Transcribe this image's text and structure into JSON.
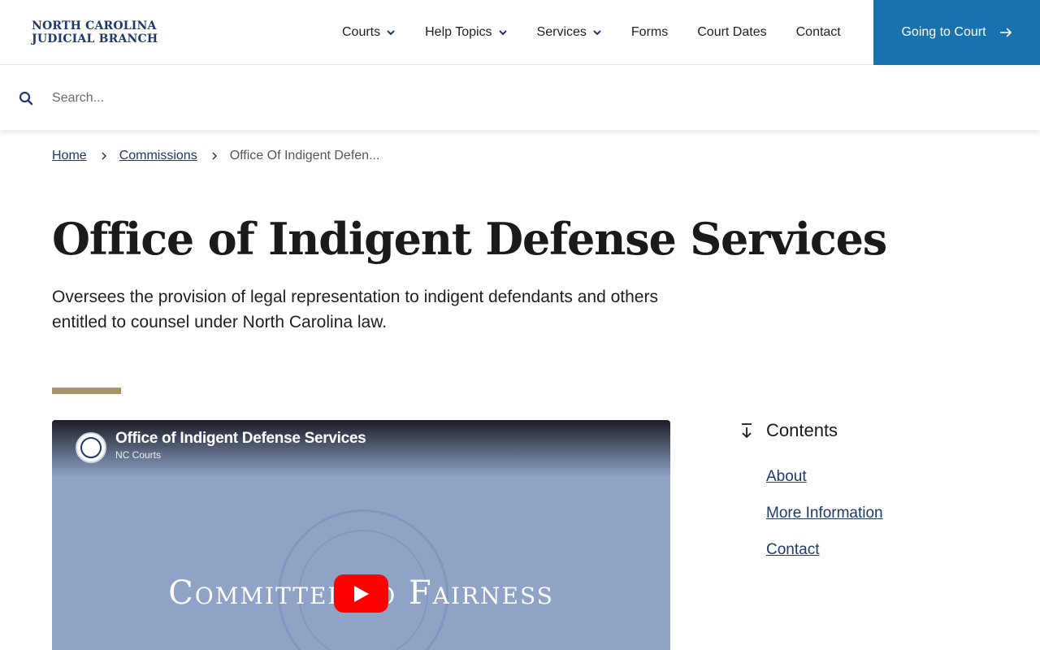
{
  "header": {
    "logo_line1": "NORTH CAROLINA",
    "logo_line2": "JUDICIAL BRANCH",
    "nav": [
      {
        "label": "Courts",
        "dropdown": true
      },
      {
        "label": "Help Topics",
        "dropdown": true
      },
      {
        "label": "Services",
        "dropdown": true
      },
      {
        "label": "Forms",
        "dropdown": false
      },
      {
        "label": "Court Dates",
        "dropdown": false
      },
      {
        "label": "Contact",
        "dropdown": false
      }
    ],
    "cta_label": "Going to Court",
    "cta_color": "#1872b0"
  },
  "search": {
    "placeholder": "Search...",
    "value": ""
  },
  "breadcrumb": {
    "home": "Home",
    "commissions": "Commissions",
    "current": "Office Of Indigent Defen..."
  },
  "page": {
    "title": "Office of Indigent Defense Services",
    "lead": "Oversees the provision of legal representation to indigent defendants and others entitled to counsel under North Carolina law.",
    "accent_color": "#a8936a"
  },
  "video": {
    "title": "Office of Indigent Defense Services",
    "channel": "NC Courts",
    "banner_text": "Committed to Fairness"
  },
  "contents": {
    "heading": "Contents",
    "items": [
      "About",
      "More Information",
      "Contact"
    ]
  }
}
